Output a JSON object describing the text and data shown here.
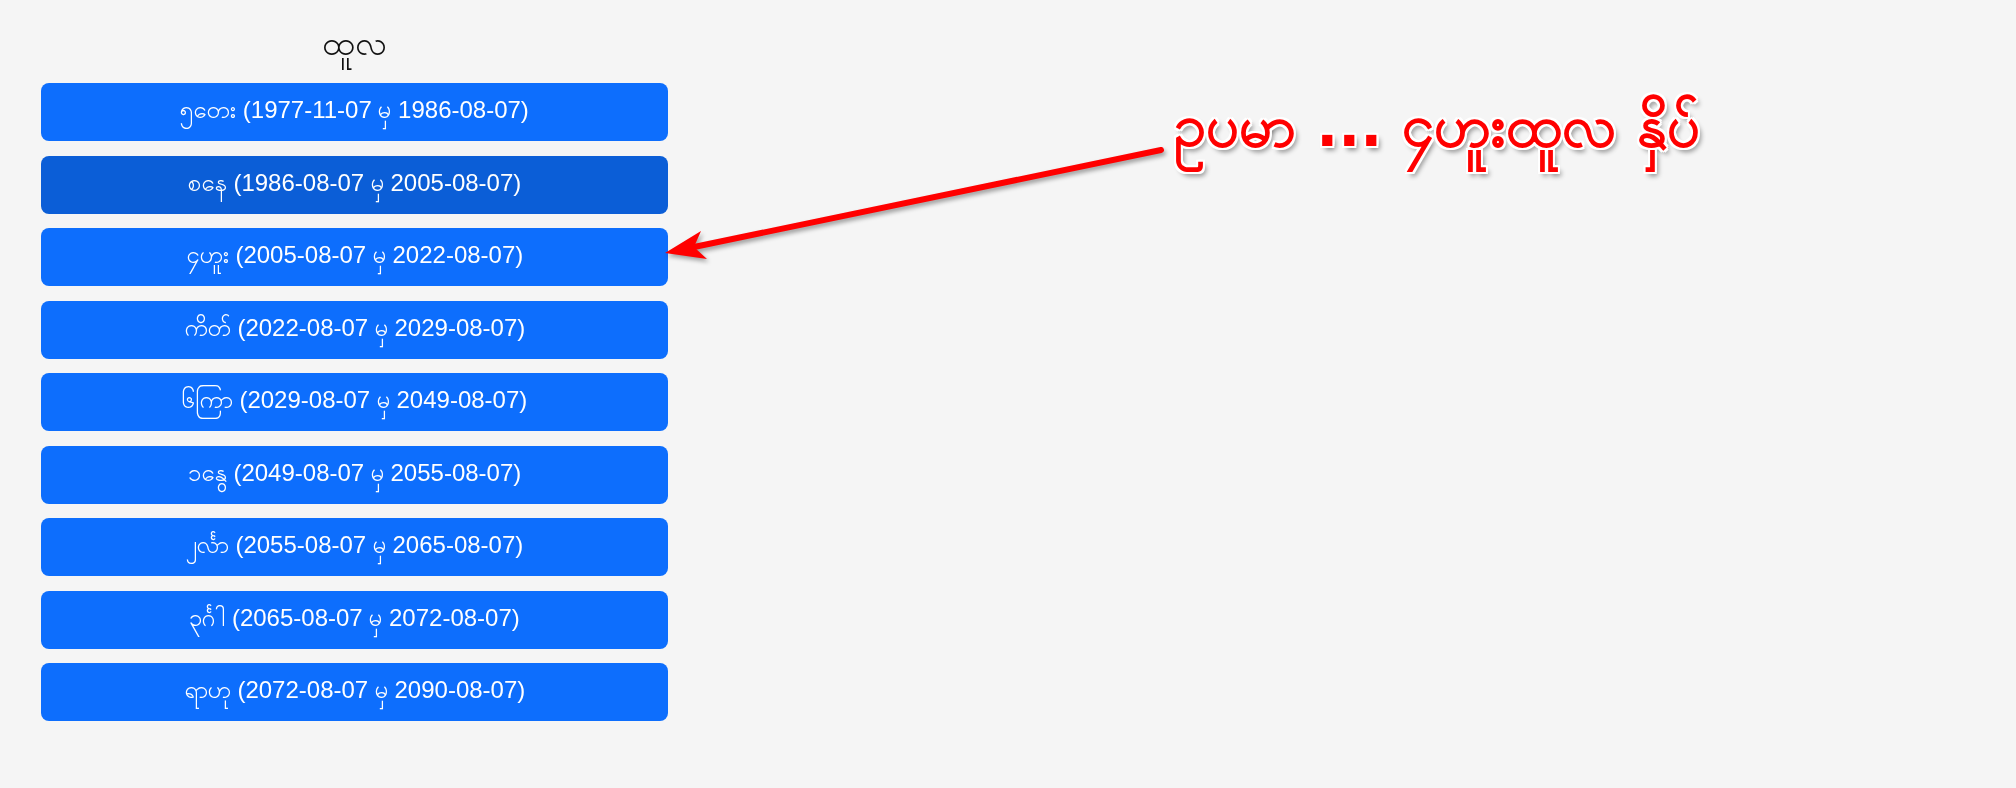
{
  "panel": {
    "title": "ထူလ",
    "periods": [
      {
        "label": "၅တေး (1977-11-07 မှ 1986-08-07)",
        "selected": false
      },
      {
        "label": "စနေ (1986-08-07 မှ 2005-08-07)",
        "selected": true
      },
      {
        "label": "၄ဟူး (2005-08-07 မှ 2022-08-07)",
        "selected": false
      },
      {
        "label": "ကိတ် (2022-08-07 မှ 2029-08-07)",
        "selected": false
      },
      {
        "label": "၆ကြာ (2029-08-07 မှ 2049-08-07)",
        "selected": false
      },
      {
        "label": "၁နွေ (2049-08-07 မှ 2055-08-07)",
        "selected": false
      },
      {
        "label": "၂င်္လာ (2055-08-07 မှ 2065-08-07)",
        "selected": false
      },
      {
        "label": "၃င်္ဂါ (2065-08-07 မှ 2072-08-07)",
        "selected": false
      },
      {
        "label": "ရာဟု (2072-08-07 မှ 2090-08-07)",
        "selected": false
      }
    ]
  },
  "annotation": {
    "text": "ဥပမာ ... ၄ဟူးထူလ နှိပ်"
  }
}
